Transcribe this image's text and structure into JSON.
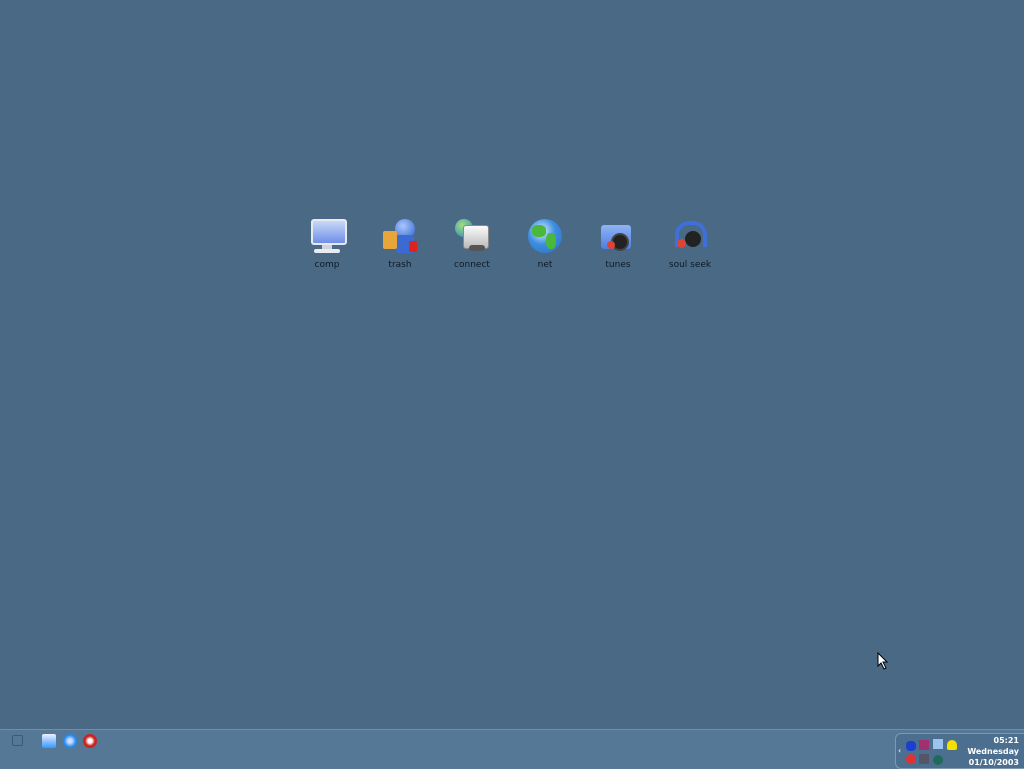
{
  "desktop": {
    "icons": [
      {
        "label": "comp",
        "icon": "computer-icon"
      },
      {
        "label": "trash",
        "icon": "trash-icon"
      },
      {
        "label": "connect",
        "icon": "network-connect-icon"
      },
      {
        "label": "net",
        "icon": "globe-icon"
      },
      {
        "label": "tunes",
        "icon": "music-folder-icon"
      },
      {
        "label": "soul seek",
        "icon": "headphones-icon"
      }
    ]
  },
  "taskbar": {
    "quick_launch": [
      "show-desktop-icon",
      "outlook-icon",
      "internet-explorer-icon",
      "media-player-icon"
    ],
    "clock": {
      "time": "05:21",
      "day": "Wednesday",
      "date": "01/10/2003"
    }
  }
}
